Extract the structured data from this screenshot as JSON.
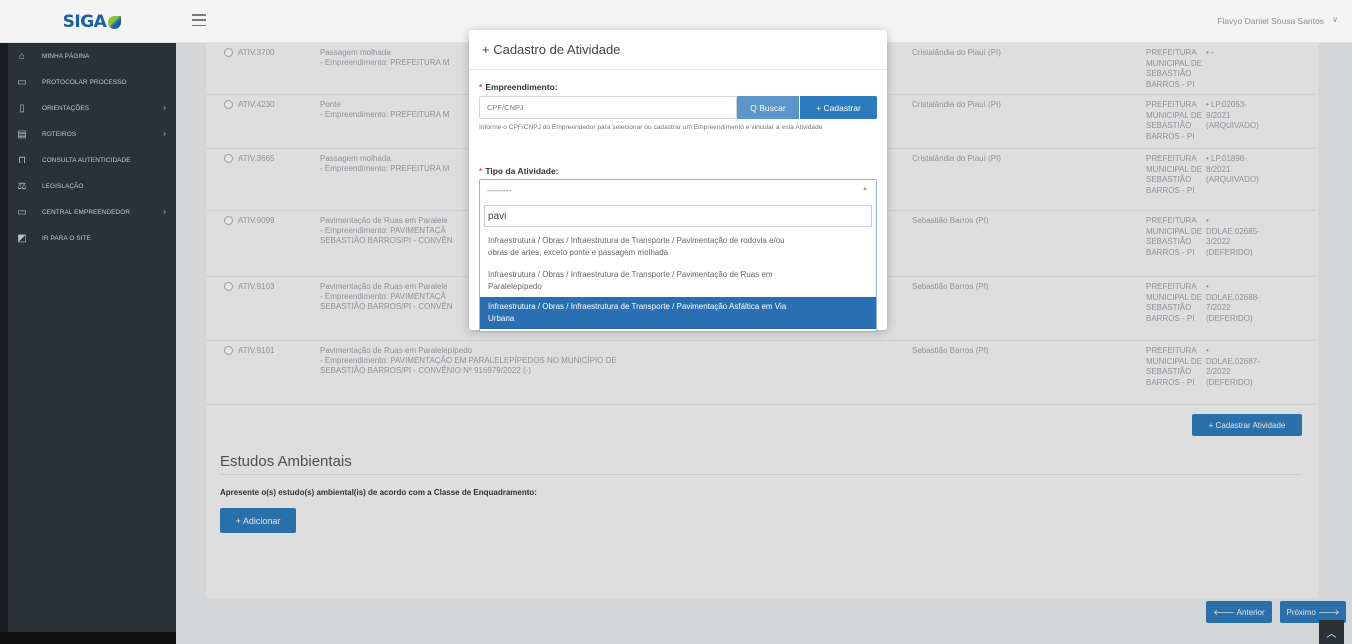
{
  "header": {
    "logo": "SIGA",
    "user_name": "Flavyo Daniel Sousa Santos",
    "user_caret": "∨"
  },
  "sidebar": {
    "items": [
      {
        "label": "MINHA PÁGINA",
        "icon": "⌂",
        "icon_name": "home-icon",
        "chevron": false
      },
      {
        "label": "PROTOCOLAR PROCESSO",
        "icon": "▭",
        "icon_name": "folder-icon",
        "chevron": false
      },
      {
        "label": "ORIENTAÇÕES",
        "icon": "▯",
        "icon_name": "book-icon",
        "chevron": true
      },
      {
        "label": "ROTEIROS",
        "icon": "▤",
        "icon_name": "document-icon",
        "chevron": true
      },
      {
        "label": "CONSULTA AUTENTICIDADE",
        "icon": "⊓",
        "icon_name": "lock-icon",
        "chevron": false
      },
      {
        "label": "LEGISLAÇÃO",
        "icon": "⚖",
        "icon_name": "scale-icon",
        "chevron": false
      },
      {
        "label": "CENTRAL EMPREENDEDOR",
        "icon": "▭",
        "icon_name": "monitor-icon",
        "chevron": true
      },
      {
        "label": "IR PARA O SITE",
        "icon": "◩",
        "icon_name": "external-site-icon",
        "chevron": false
      }
    ],
    "chevron_glyph": "›"
  },
  "activities": [
    {
      "code": "ATIV.3700",
      "desc": [
        "Passagem molhada",
        "- Empreendimento: PREFEITURA M"
      ],
      "municipio": "Cristalândia do Piauí (PI)",
      "orgao": [
        "PREFEITURA",
        "MUNICIPAL DE",
        "SEBASTIÃO",
        "BARROS - PI"
      ],
      "licenca": [
        "• -"
      ]
    },
    {
      "code": "ATIV.4230",
      "desc": [
        "Ponte",
        "- Empreendimento: PREFEITURA M"
      ],
      "municipio": "Cristalândia do Piauí (PI)",
      "orgao": [
        "PREFEITURA",
        "MUNICIPAL DE",
        "SEBASTIÃO",
        "BARROS - PI"
      ],
      "licenca": [
        "• LP.02053-",
        "9/2021",
        "(ARQUIVADO)"
      ]
    },
    {
      "code": "ATIV.3665",
      "desc": [
        "Passagem molhada",
        "- Empreendimento: PREFEITURA M"
      ],
      "municipio": "Cristalândia do Piauí (PI)",
      "orgao": [
        "PREFEITURA",
        "MUNICIPAL DE",
        "SEBASTIÃO",
        "BARROS - PI"
      ],
      "licenca": [
        "• LP.01898-",
        "8/2021",
        "(ARQUIVADO)"
      ]
    },
    {
      "code": "ATIV.9099",
      "desc": [
        "Pavimentação de Ruas em Paralele",
        "- Empreendimento: PAVIMENTAÇÃ",
        "SEBASTIÃO BARROS/PI - CONVÊN"
      ],
      "municipio": "Sebastião Barros (PI)",
      "orgao": [
        "PREFEITURA",
        "MUNICIPAL DE",
        "SEBASTIÃO",
        "BARROS - PI"
      ],
      "licenca": [
        "•",
        "DDLAE.02685-",
        "3/2022",
        "(DEFERIDO)"
      ]
    },
    {
      "code": "ATIV.9103",
      "desc": [
        "Pavimentação de Ruas em Paralele",
        "- Empreendimento: PAVIMENTAÇÃ",
        "SEBASTIÃO BARROS/PI - CONVÊN"
      ],
      "municipio": "Sebastião Barros (PI)",
      "orgao": [
        "PREFEITURA",
        "MUNICIPAL DE",
        "SEBASTIÃO",
        "BARROS - PI"
      ],
      "licenca": [
        "•",
        "DDLAE.02688-",
        "7/2022",
        "(DEFERIDO)"
      ]
    },
    {
      "code": "ATIV.9101",
      "desc": [
        "Pavimentação de Ruas em Paralelepípedo",
        "- Empreendimento: PAVIMENTAÇÃO EM PARALELEPÍPEDOS NO MUNICÍPIO DE",
        "SEBASTIÃO BARROS/PI - CONVÊNIO Nº 916979/2022 (-)"
      ],
      "municipio": "Sebastião Barros (PI)",
      "orgao": [
        "PREFEITURA",
        "MUNICIPAL DE",
        "SEBASTIÃO",
        "BARROS - PI"
      ],
      "licenca": [
        "•",
        "DDLAE.02687-",
        "2/2022",
        "(DEFERIDO)"
      ]
    }
  ],
  "main": {
    "cadastrar_atividade": "+ Cadastrar Atividade",
    "section_title": "Estudos Ambientais",
    "section_sub": "Apresente o(s) estudo(s) ambiental(is) de acordo com a Classe de Enquadramento:",
    "adicionar": "+ Adicionar",
    "anterior": "🡐 Anterior",
    "proximo": "Próximo 🡒",
    "scroll_top": "︿"
  },
  "modal": {
    "title": "+ Cadastro de Atividade",
    "empreendimento_label": "Empreendimento:",
    "required_mark": "*",
    "cpf_placeholder": "CPF/CNPJ",
    "buscar": "Q Buscar",
    "cadastrar": "+ Cadastrar",
    "help": "Informe o CPF/CNPJ do Empreendedor para selecionar ou cadastrar um Empreendimento e vincular a esta Atividade",
    "tipo_label": "Tipo da Atividade:",
    "select_value": "---------",
    "select_caret": "▲",
    "search_value": "pavi",
    "options": [
      {
        "line1": "Infraestrutura / Obras / Infraestrutura de Transporte / Pavimentação de rodovia e/ou",
        "line2": "obras de artes, exceto ponte e passagem molhada",
        "selected": false
      },
      {
        "line1": "Infraestrutura / Obras / Infraestrutura de Transporte / Pavimentação de Ruas em",
        "line2": "Paralelepípedo",
        "selected": false
      },
      {
        "line1": "Infraestrutura / Obras / Infraestrutura de Transporte / Pavimentação Asfáltica em Via",
        "line2": "Urbana",
        "selected": true
      }
    ]
  }
}
